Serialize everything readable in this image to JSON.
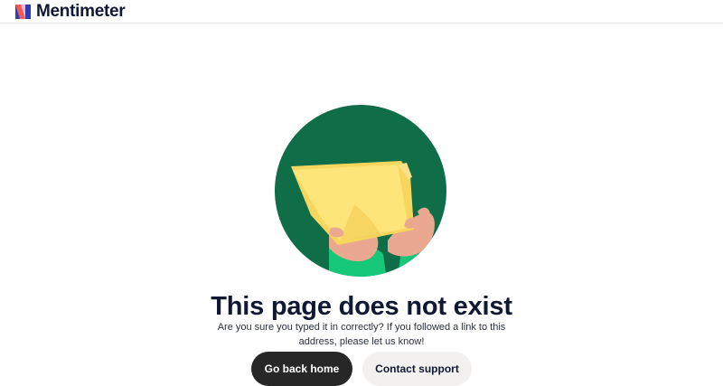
{
  "header": {
    "brand_name": "Mentimeter",
    "logo_icon": "mentimeter-logo-icon"
  },
  "main": {
    "illustration_icon": "hands-holding-folder-illustration",
    "title": "This page does not exist",
    "message": "Are you sure you typed it in correctly? If you followed a link to this address, please let us know!",
    "primary_button": "Go back home",
    "secondary_button": "Contact support"
  },
  "colors": {
    "circle_green": "#0f6d47",
    "folder_yellow": "#fde57a",
    "sleeve_green": "#16c77a",
    "skin": "#e9a88f",
    "primary_button_bg": "#272727",
    "secondary_button_bg": "#f2f1ef",
    "logo_blue": "#2c3eb1",
    "logo_red": "#f25a5a",
    "logo_pink": "#f7b3c6"
  }
}
